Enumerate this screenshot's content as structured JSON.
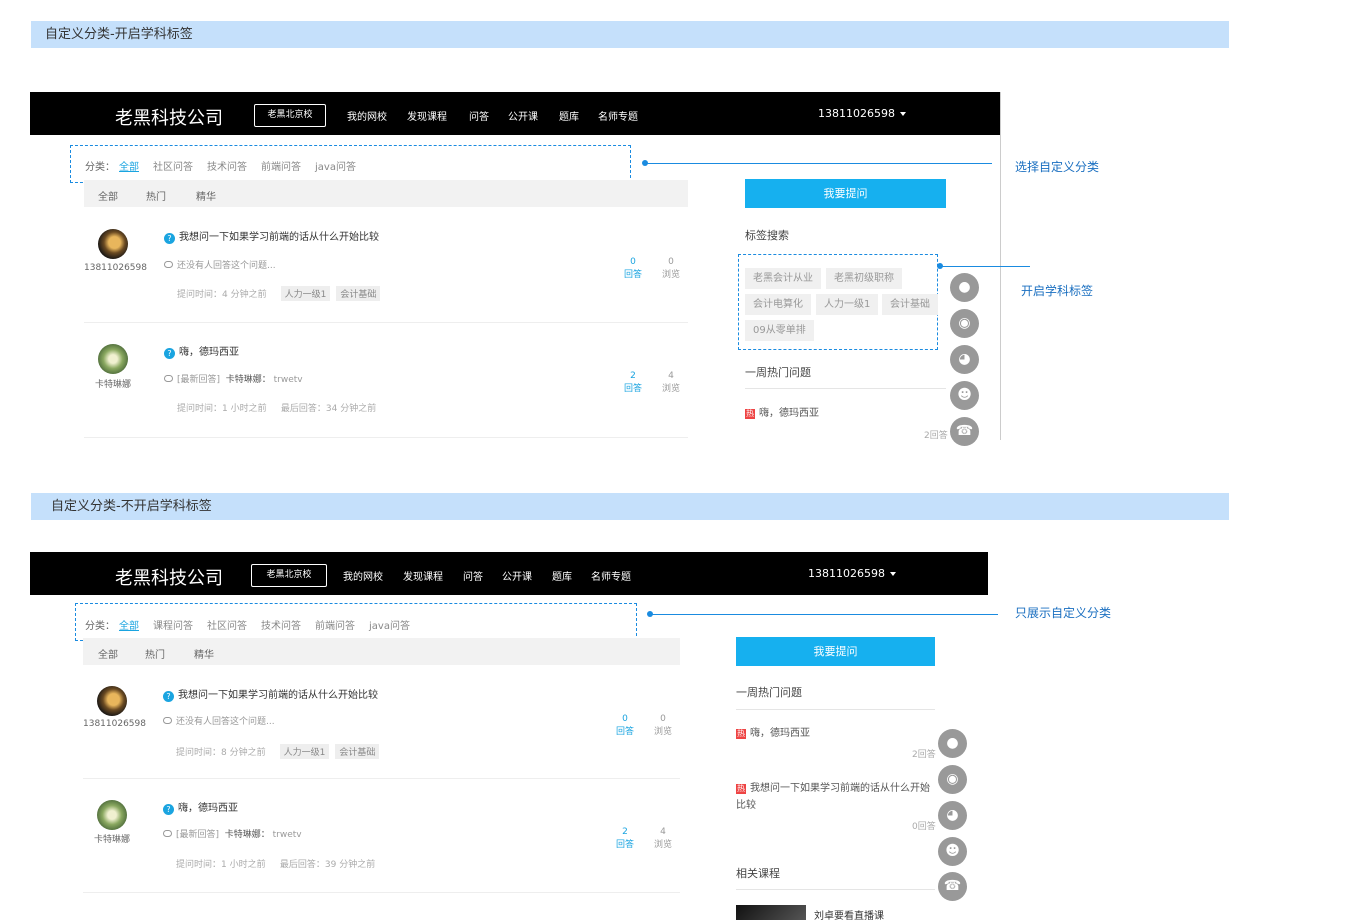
{
  "section1": {
    "banner": "自定义分类-开启学科标签",
    "nav": {
      "brand": "老黑科技公司",
      "school": "老黑北京校",
      "links": [
        "我的网校",
        "发现课程",
        "问答",
        "公开课",
        "题库",
        "名师专题"
      ],
      "account": "13811026598"
    },
    "categories": {
      "label": "分类：",
      "items": [
        "全部",
        "社区问答",
        "技术问答",
        "前端问答",
        "java问答"
      ]
    },
    "tabs": [
      "全部",
      "热门",
      "精华"
    ],
    "questions": [
      {
        "user": "13811026598",
        "title": "我想问一下如果学习前端的话从什么开始比较",
        "sub": "还没有人回答这个问题...",
        "time": "提问时间：4 分钟之前",
        "tags": [
          "人力一级1",
          "会计基础"
        ],
        "answers": "0",
        "answers_label": "回答",
        "views": "0",
        "views_label": "浏览"
      },
      {
        "user": "卡特琳娜",
        "title": "嗨，德玛西亚",
        "sub_prefix": "[最新回答]",
        "sub_user": "卡特琳娜：",
        "sub_text": "trwetv",
        "time": "提问时间：1 小时之前",
        "last": "最后回答：34 分钟之前",
        "answers": "2",
        "answers_label": "回答",
        "views": "4",
        "views_label": "浏览"
      }
    ],
    "sidebar": {
      "ask": "我要提问",
      "tag_search": "标签搜索",
      "tags": [
        "老黑会计从业",
        "老黑初级职称",
        "会计电算化",
        "人力一级1",
        "会计基础",
        "09从零单排"
      ],
      "hot_title": "一周热门问题",
      "hot_items": [
        {
          "badge": "热",
          "text": "嗨，德玛西亚",
          "count": "2回答"
        }
      ]
    },
    "annotations": {
      "a1": "选择自定义分类",
      "a2": "开启学科标签"
    }
  },
  "section2": {
    "banner": "自定义分类-不开启学科标签",
    "nav": {
      "brand": "老黑科技公司",
      "school": "老黑北京校",
      "links": [
        "我的网校",
        "发现课程",
        "问答",
        "公开课",
        "题库",
        "名师专题"
      ],
      "account": "13811026598"
    },
    "categories": {
      "label": "分类：",
      "items": [
        "全部",
        "课程问答",
        "社区问答",
        "技术问答",
        "前端问答",
        "java问答"
      ]
    },
    "tabs": [
      "全部",
      "热门",
      "精华"
    ],
    "questions": [
      {
        "user": "13811026598",
        "title": "我想问一下如果学习前端的话从什么开始比较",
        "sub": "还没有人回答这个问题...",
        "time": "提问时间：8 分钟之前",
        "tags": [
          "人力一级1",
          "会计基础"
        ],
        "answers": "0",
        "answers_label": "回答",
        "views": "0",
        "views_label": "浏览"
      },
      {
        "user": "卡特琳娜",
        "title": "嗨，德玛西亚",
        "sub_prefix": "[最新回答]",
        "sub_user": "卡特琳娜：",
        "sub_text": "trwetv",
        "time": "提问时间：1 小时之前",
        "last": "最后回答：39 分钟之前",
        "answers": "2",
        "answers_label": "回答",
        "views": "4",
        "views_label": "浏览"
      }
    ],
    "sidebar": {
      "ask": "我要提问",
      "hot_title": "一周热门问题",
      "hot_items": [
        {
          "badge": "热",
          "text": "嗨，德玛西亚",
          "count": "2回答"
        },
        {
          "badge": "热",
          "text": "我想问一下如果学习前端的话从什么开始比较",
          "count": "0回答"
        }
      ],
      "related_title": "相关课程",
      "course_title": "刘卓要看直播课"
    },
    "annotations": {
      "a1": "只展示自定义分类"
    }
  },
  "float_icons": [
    "qq-icon",
    "wechat-icon",
    "weibo-icon",
    "user-service-icon",
    "phone-icon"
  ],
  "colors": {
    "banner": "#c5e0fb",
    "accent": "#16b0ef",
    "annotation": "#1a6fc0",
    "hot": "#ee4444"
  }
}
